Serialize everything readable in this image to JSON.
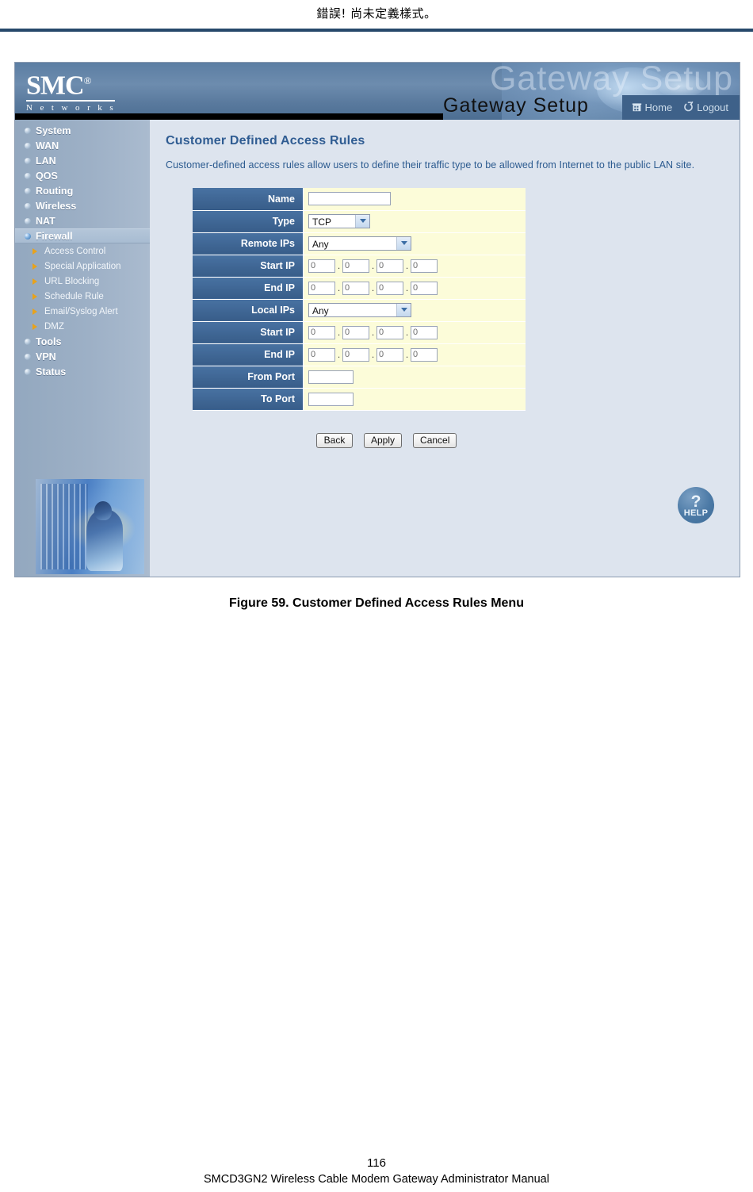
{
  "document": {
    "header_text": "錯誤! 尚未定義樣式。",
    "caption": "Figure 59. Customer Defined Access Rules Menu",
    "page_number": "116",
    "footer_text": "SMCD3GN2 Wireless Cable Modem Gateway Administrator Manual"
  },
  "banner": {
    "logo_main": "SMC",
    "logo_reg": "®",
    "logo_sub": "N e t w o r k s",
    "watermark": "Gateway Setup",
    "title": "Gateway  Setup",
    "nav": [
      {
        "label": "Home",
        "icon": "home-icon"
      },
      {
        "label": "Logout",
        "icon": "logout-icon"
      }
    ]
  },
  "sidebar": {
    "items": [
      {
        "label": "System",
        "active": false
      },
      {
        "label": "WAN",
        "active": false
      },
      {
        "label": "LAN",
        "active": false
      },
      {
        "label": "QOS",
        "active": false
      },
      {
        "label": "Routing",
        "active": false
      },
      {
        "label": "Wireless",
        "active": false
      },
      {
        "label": "NAT",
        "active": false
      },
      {
        "label": "Firewall",
        "active": true
      },
      {
        "label": "Tools",
        "active": false
      },
      {
        "label": "VPN",
        "active": false
      },
      {
        "label": "Status",
        "active": false
      }
    ],
    "sub_items": [
      {
        "label": "Access Control"
      },
      {
        "label": "Special Application"
      },
      {
        "label": "URL Blocking"
      },
      {
        "label": "Schedule Rule"
      },
      {
        "label": "Email/Syslog Alert"
      },
      {
        "label": "DMZ"
      }
    ]
  },
  "main": {
    "title": "Customer Defined Access Rules",
    "description": "Customer-defined access rules allow users to define their traffic type to be allowed from Internet to the public LAN site.",
    "form": {
      "name": {
        "label": "Name",
        "value": ""
      },
      "type": {
        "label": "Type",
        "value": "TCP"
      },
      "remote_ips": {
        "label": "Remote IPs",
        "value": "Any"
      },
      "remote_start_ip": {
        "label": "Start IP",
        "octets": [
          "0",
          "0",
          "0",
          "0"
        ]
      },
      "remote_end_ip": {
        "label": "End IP",
        "octets": [
          "0",
          "0",
          "0",
          "0"
        ]
      },
      "local_ips": {
        "label": "Local IPs",
        "value": "Any"
      },
      "local_start_ip": {
        "label": "Start IP",
        "octets": [
          "0",
          "0",
          "0",
          "0"
        ]
      },
      "local_end_ip": {
        "label": "End IP",
        "octets": [
          "0",
          "0",
          "0",
          "0"
        ]
      },
      "from_port": {
        "label": "From Port",
        "value": ""
      },
      "to_port": {
        "label": "To Port",
        "value": ""
      }
    },
    "buttons": [
      {
        "label": "Back"
      },
      {
        "label": "Apply"
      },
      {
        "label": "Cancel"
      }
    ],
    "help": {
      "mark": "?",
      "label": "HELP"
    }
  },
  "colors": {
    "rule": "#27496b",
    "label_blue": "#3f6694",
    "field_yellow": "#fcfcd9",
    "content_bg": "#dde4ee",
    "title_blue": "#2f5c92",
    "sub_marker": "#e8a21c"
  }
}
